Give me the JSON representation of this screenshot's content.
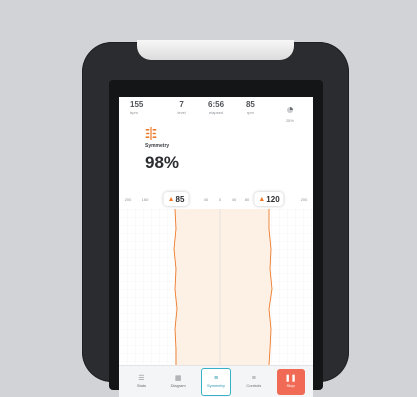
{
  "stats": [
    {
      "value": "155",
      "unit": "bpm"
    },
    {
      "value": "7",
      "unit": "level"
    },
    {
      "value": "6:56",
      "unit": "elapsed"
    },
    {
      "value": "85",
      "unit": "rpm"
    },
    {
      "value": "",
      "unit": "25%"
    }
  ],
  "symmetry": {
    "label": "Symmetry",
    "value": "98%"
  },
  "axis": {
    "ticks": [
      "200",
      "160",
      "120",
      "80",
      "40",
      "0",
      "40",
      "80",
      "120",
      "160",
      "200"
    ],
    "left_value": "85",
    "right_value": "120"
  },
  "nav": {
    "items": [
      {
        "label": "Stats",
        "icon": "list-icon"
      },
      {
        "label": "Diagram",
        "icon": "bar-chart-icon"
      },
      {
        "label": "Symmetry",
        "icon": "symmetry-icon"
      },
      {
        "label": "Controls",
        "icon": "sliders-icon"
      },
      {
        "label": "Stop",
        "icon": "pause-icon"
      }
    ]
  },
  "colors": {
    "accent": "#ee7a2a",
    "active": "#3ab0c6",
    "stop": "#f06a55"
  }
}
